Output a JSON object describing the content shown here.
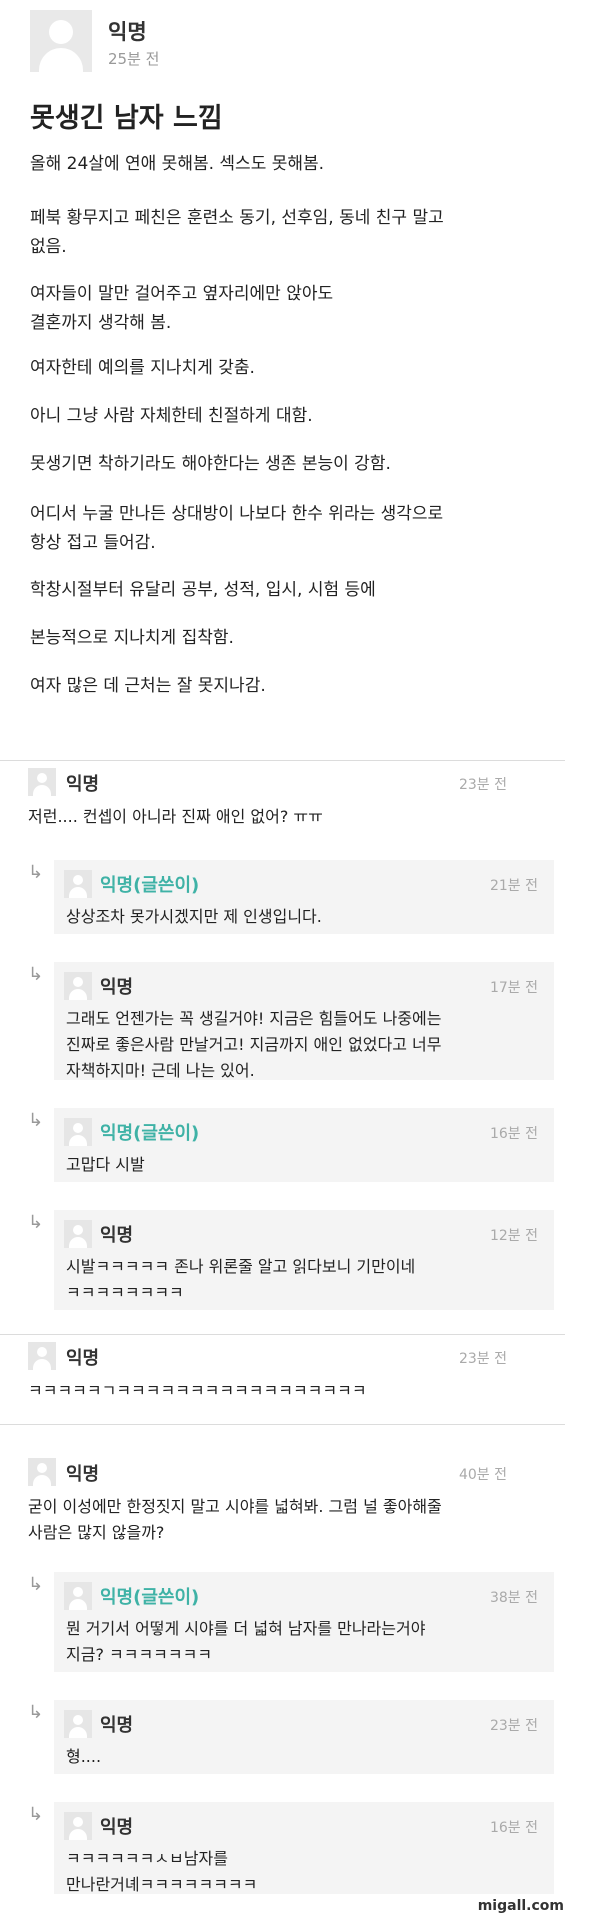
{
  "post": {
    "author": "익명",
    "time": "25분 전",
    "title": "못생긴 남자 느낌",
    "paragraphs": [
      [
        "올해 24살에 연애 못해봄. 섹스도 못해봄."
      ],
      [
        "페북 황무지고 페친은 훈련소 동기, 선후임, 동네 친구 말고",
        "없음."
      ],
      [
        "여자들이 말만 걸어주고 옆자리에만 앉아도",
        "결혼까지 생각해 봄."
      ],
      [
        "여자한테 예의를 지나치게 갖춤."
      ],
      [
        "아니 그냥 사람 자체한테 친절하게 대함."
      ],
      [
        "못생기면 착하기라도 해야한다는 생존 본능이 강함."
      ],
      [
        "어디서 누굴 만나든 상대방이 나보다 한수 위라는 생각으로",
        "항상 접고 들어감."
      ],
      [
        "학창시절부터 유달리 공부, 성적, 입시, 시험 등에"
      ],
      [
        "본능적으로 지나치게 집착함."
      ],
      [
        "여자 많은 데 근처는 잘 못지나감."
      ]
    ]
  },
  "comments": [
    {
      "author": "익명",
      "time": "23분 전",
      "lines": [
        "저런.... 컨셉이 아니라 진짜 애인 없어? ㅠㅠ"
      ],
      "replies": [
        {
          "author": "익명(글쓴이)",
          "op": true,
          "time": "21분 전",
          "lines": [
            "상상조차 못가시겠지만 제 인생입니다."
          ]
        },
        {
          "author": "익명",
          "op": false,
          "time": "17분 전",
          "lines": [
            "그래도 언젠가는 꼭 생길거야! 지금은 힘들어도 나중에는",
            "진짜로 좋은사람 만날거고! 지금까지 애인 없었다고 너무",
            "자책하지마! 근데 나는 있어."
          ]
        },
        {
          "author": "익명(글쓴이)",
          "op": true,
          "time": "16분 전",
          "lines": [
            "고맙다 시발"
          ]
        },
        {
          "author": "익명",
          "op": false,
          "time": "12분 전",
          "lines": [
            "시발ㅋㅋㅋㅋㅋ 존나 위론줄 알고 읽다보니 기만이네",
            "ㅋㅋㅋㅋㅋㅋㅋㅋ"
          ]
        }
      ]
    },
    {
      "author": "익명",
      "time": "23분 전",
      "lines": [
        "ㅋㅋㅋㅋㅋㄱㅋㅋㅋㅋㅋㅋㅋㅋㅋㅋㅋㅋㅋㅋㅋㅋㅋ"
      ],
      "replies": []
    },
    {
      "author": "익명",
      "time": "40분 전",
      "lines": [
        "굳이 이성에만 한정짓지 말고 시야를 넓혀봐. 그럼 널 좋아해줄",
        "사람은 많지 않을까?"
      ],
      "replies": [
        {
          "author": "익명(글쓴이)",
          "op": true,
          "time": "38분 전",
          "lines": [
            "뭔 거기서 어떻게 시야를 더 넓혀 남자를 만나라는거야",
            "지금? ㅋㅋㅋㅋㅋㅋㅋ"
          ]
        },
        {
          "author": "익명",
          "op": false,
          "time": "23분 전",
          "lines": [
            "형...."
          ]
        },
        {
          "author": "익명",
          "op": false,
          "time": "16분 전",
          "lines": [
            "ㅋㅋㅋㅋㅋㅋㅅㅂ남자를",
            "만나란거녜ㅋㅋㅋㅋㅋㅋㅋㅋ"
          ]
        }
      ]
    }
  ],
  "watermark": "migall.com",
  "colors": {
    "op_author": "#3fb2a6",
    "reply_bg": "#f4f4f4",
    "time": "#aaaaaa"
  }
}
